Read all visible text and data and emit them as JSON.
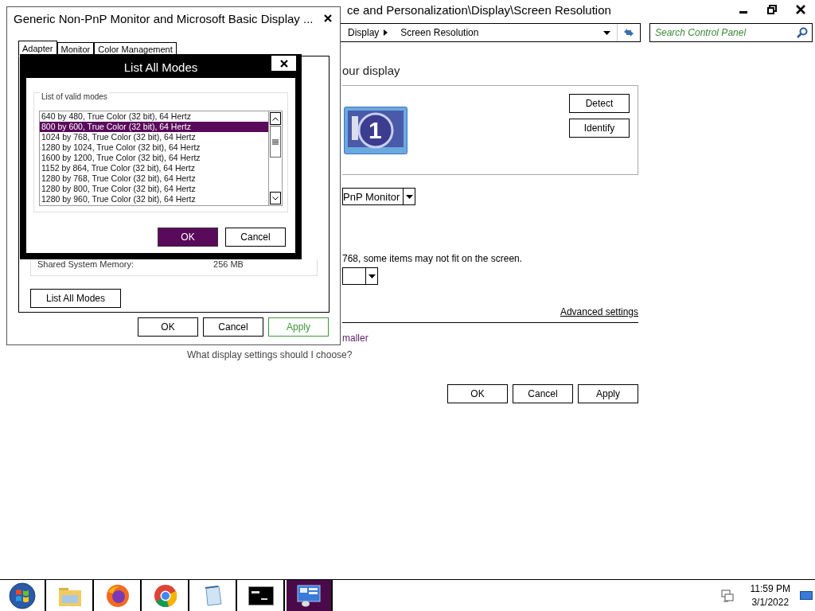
{
  "control_panel": {
    "title": "ce and Personalization\\Display\\Screen Resolution",
    "breadcrumb": [
      "Display",
      "Screen Resolution"
    ],
    "search": {
      "placeholder": "Search Control Panel"
    },
    "heading": "our display",
    "display_number": "1",
    "side_buttons": [
      "Detect",
      "Identify"
    ],
    "display_select": "PnP Monitor",
    "warning": "768, some items may not fit on the screen.",
    "advanced_link": "Advanced settings",
    "smaller_link": "maller",
    "help_link": "What display settings should I choose?",
    "buttons": [
      "OK",
      "Cancel",
      "Apply"
    ]
  },
  "properties_dialog": {
    "title": "Generic Non-PnP Monitor and Microsoft Basic Display ...",
    "tabs": [
      {
        "label": "Adapter",
        "selected": true
      },
      {
        "label": "Monitor",
        "selected": false
      },
      {
        "label": "Color Management",
        "selected": false
      }
    ],
    "shared_memory_label": "Shared System Memory:",
    "shared_memory_value": "256 MB",
    "list_all_modes_button": "List All Modes",
    "buttons": [
      {
        "label": "OK",
        "disabled": false
      },
      {
        "label": "Cancel",
        "disabled": false
      },
      {
        "label": "Apply",
        "disabled": true
      }
    ]
  },
  "modes_dialog": {
    "title": "List All Modes",
    "group_label": "List of valid modes",
    "modes": [
      {
        "label": "640 by 480, True Color (32 bit), 64 Hertz",
        "selected": false
      },
      {
        "label": "800 by 600, True Color (32 bit), 64 Hertz",
        "selected": true
      },
      {
        "label": "1024 by 768, True Color (32 bit), 64 Hertz",
        "selected": false
      },
      {
        "label": "1280 by 1024, True Color (32 bit), 64 Hertz",
        "selected": false
      },
      {
        "label": "1600 by 1200, True Color (32 bit), 64 Hertz",
        "selected": false
      },
      {
        "label": "1152 by 864, True Color (32 bit), 64 Hertz",
        "selected": false
      },
      {
        "label": "1280 by 768, True Color (32 bit), 64 Hertz",
        "selected": false
      },
      {
        "label": "1280 by 800, True Color (32 bit), 64 Hertz",
        "selected": false
      },
      {
        "label": "1280 by 960, True Color (32 bit), 64 Hertz",
        "selected": false
      }
    ],
    "buttons": [
      {
        "label": "OK",
        "default": true
      },
      {
        "label": "Cancel",
        "default": false
      }
    ]
  },
  "taskbar": {
    "items": [
      {
        "kind": "start",
        "selected": false
      },
      {
        "kind": "folder",
        "selected": false
      },
      {
        "kind": "firefox",
        "selected": false
      },
      {
        "kind": "chrome",
        "selected": false
      },
      {
        "kind": "notepad",
        "selected": false
      },
      {
        "kind": "terminal",
        "selected": false
      },
      {
        "kind": "control-panel",
        "selected": true
      }
    ],
    "time": "11:59 PM",
    "date": "3/1/2022"
  }
}
